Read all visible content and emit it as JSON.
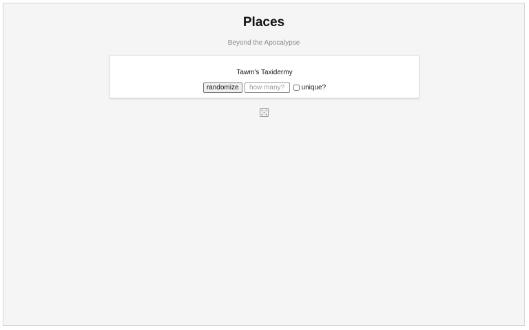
{
  "page": {
    "title": "Places",
    "subtitle": "Beyond the Apocalypse"
  },
  "generator": {
    "result": "Tawm's Taxidermy",
    "randomize_label": "randomize",
    "count_placeholder": "how many?",
    "count_value": "",
    "unique_label": "unique?",
    "unique_checked": false
  },
  "icons": {
    "dice": "dice-five-icon"
  }
}
